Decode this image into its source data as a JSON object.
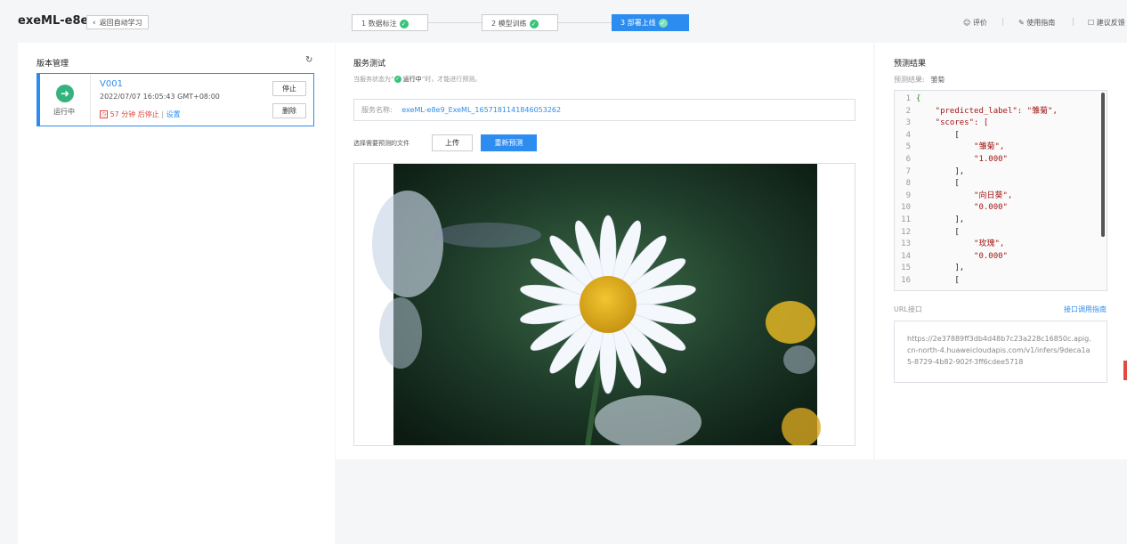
{
  "header": {
    "app_title": "exeML-e8e9",
    "back_label": "返回自动学习",
    "steps": [
      {
        "label": "1 数据标注",
        "state": "done"
      },
      {
        "label": "2 模型训练",
        "state": "done"
      },
      {
        "label": "3 部署上线",
        "state": "active"
      }
    ],
    "links": [
      "评价",
      "使用指南",
      "建议反馈"
    ]
  },
  "version_panel": {
    "title": "版本管理",
    "refresh_icon": "refresh-icon",
    "card": {
      "status": "运行中",
      "version": "V001",
      "datetime": "2022/07/07 16:05:43 GMT+08:00",
      "countdown": "57 分钟 后停止",
      "setting": "设置",
      "stop_label": "停止",
      "delete_label": "删除"
    }
  },
  "service_test": {
    "title": "服务测试",
    "hint_prefix": "当服务状态为“",
    "hint_status": "运行中",
    "hint_suffix": "”时，才能进行预测。",
    "service_name_label": "服务名称:",
    "service_name_value": "exeML-e8e9_ExeML_1657181141846053262",
    "file_label": "选择需要预测的文件",
    "upload_label": "上传",
    "predict_label": "重新预测"
  },
  "result_panel": {
    "title": "预测结果",
    "result_label": "预测结果:",
    "result_value": "雏菊",
    "code_lines": [
      {
        "n": "1",
        "t": "{"
      },
      {
        "n": "2",
        "t": "    \"predicted_label\": \"雏菊\","
      },
      {
        "n": "3",
        "t": "    \"scores\": ["
      },
      {
        "n": "4",
        "t": "        ["
      },
      {
        "n": "5",
        "t": "            \"雏菊\","
      },
      {
        "n": "6",
        "t": "            \"1.000\""
      },
      {
        "n": "7",
        "t": "        ],"
      },
      {
        "n": "8",
        "t": "        ["
      },
      {
        "n": "9",
        "t": "            \"向日葵\","
      },
      {
        "n": "10",
        "t": "            \"0.000\""
      },
      {
        "n": "11",
        "t": "        ],"
      },
      {
        "n": "12",
        "t": "        ["
      },
      {
        "n": "13",
        "t": "            \"玫瑰\","
      },
      {
        "n": "14",
        "t": "            \"0.000\""
      },
      {
        "n": "15",
        "t": "        ],"
      },
      {
        "n": "16",
        "t": "        ["
      }
    ],
    "url_label": "URL接口",
    "api_guide_link": "接口调用指南",
    "url_value": "https://2e37889ff3db4d48b7c23a228c16850c.apig.cn-north-4.huaweicloudapis.com/v1/infers/9deca1a5-8729-4b82-902f-3ff6cdee5718"
  },
  "colors": {
    "primary": "#2d8cf0",
    "success": "#35c47a",
    "danger": "#e04a3f"
  }
}
